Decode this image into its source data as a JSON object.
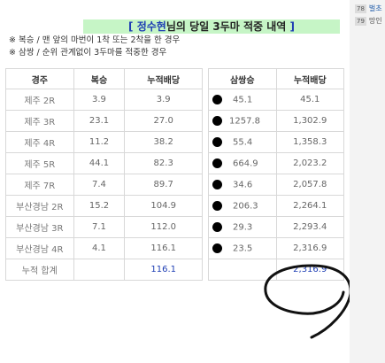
{
  "title": {
    "open": "[",
    "name": "정수현",
    "rest": "님의 당일 3두마 적중 내역",
    "close": "]"
  },
  "notes": [
    "※ 복승 / 맨 앞의 마번이 1착 또는 2착을 한 경우",
    "※ 삼쌍 / 순위 관계없이 3두마를 적중한 경우"
  ],
  "left_table": {
    "headers": [
      "경주",
      "복승",
      "누적배당"
    ],
    "rows": [
      [
        "제주 2R",
        "3.9",
        "3.9"
      ],
      [
        "제주 3R",
        "23.1",
        "27.0"
      ],
      [
        "제주 4R",
        "11.2",
        "38.2"
      ],
      [
        "제주 5R",
        "44.1",
        "82.3"
      ],
      [
        "제주 7R",
        "7.4",
        "89.7"
      ],
      [
        "부산경남 2R",
        "15.2",
        "104.9"
      ],
      [
        "부산경남 3R",
        "7.1",
        "112.0"
      ],
      [
        "부산경남 4R",
        "4.1",
        "116.1"
      ]
    ],
    "total_label": "누적 합계",
    "total_value": "116.1"
  },
  "right_table": {
    "headers": [
      "삼쌍승",
      "누적배당"
    ],
    "rows": [
      [
        "45.1",
        "45.1"
      ],
      [
        "1257.8",
        "1,302.9"
      ],
      [
        "55.4",
        "1,358.3"
      ],
      [
        "664.9",
        "2,023.2"
      ],
      [
        "34.6",
        "2,057.8"
      ],
      [
        "206.3",
        "2,264.1"
      ],
      [
        "29.3",
        "2,293.4"
      ],
      [
        "23.5",
        "2,316.9"
      ]
    ],
    "total_value": "2,316.9"
  },
  "sidebar": {
    "items": [
      {
        "num": "78",
        "text": "벌초"
      },
      {
        "num": "79",
        "text": "망인"
      }
    ]
  },
  "colors": {
    "title_bg": "#c6f5c6",
    "accent_blue": "#1e3eb4",
    "border": "#d8d8d8"
  }
}
